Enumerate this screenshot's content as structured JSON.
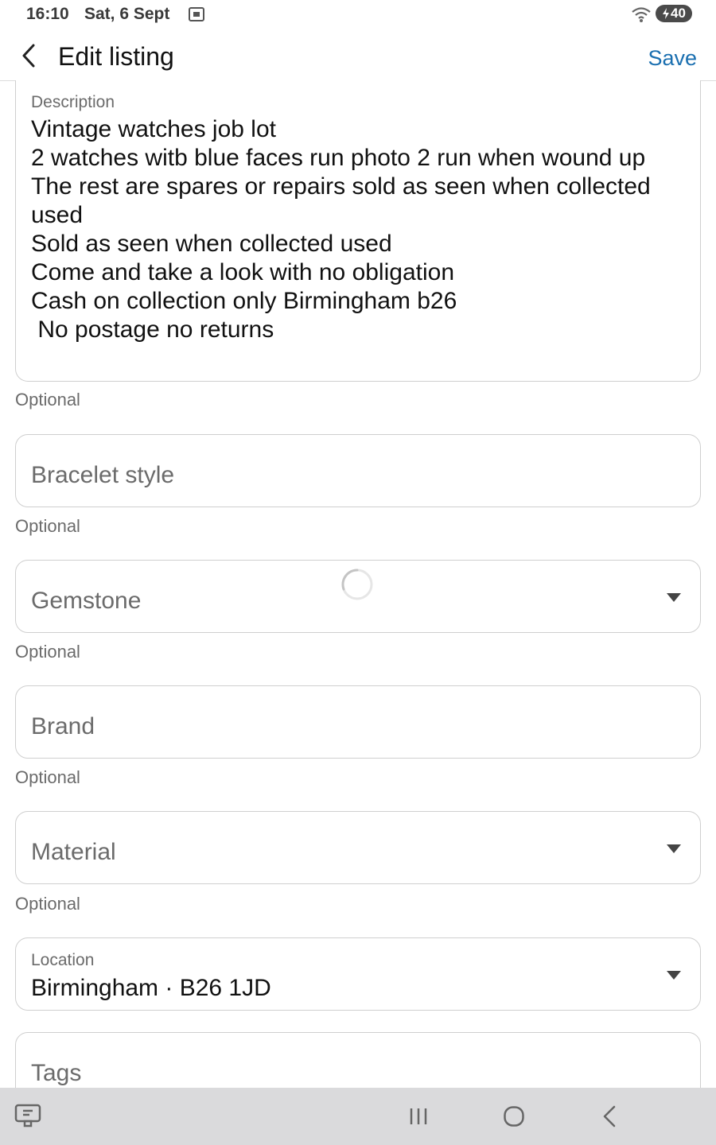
{
  "status": {
    "time": "16:10",
    "date": "Sat, 6 Sept",
    "battery": "40"
  },
  "header": {
    "title": "Edit listing",
    "save_label": "Save"
  },
  "description": {
    "label": "Description",
    "value": "Vintage watches job lot\n2 watches witb blue faces run photo 2 run when wound up\nThe rest are spares or repairs sold as seen when collected used\nSold as seen when collected used\nCome and take a look with no obligation\nCash on collection only Birmingham b26\n No postage no returns",
    "helper": "Optional"
  },
  "bracelet_style": {
    "placeholder": "Bracelet style",
    "helper": "Optional"
  },
  "gemstone": {
    "placeholder": "Gemstone",
    "helper": "Optional"
  },
  "brand": {
    "placeholder": "Brand",
    "helper": "Optional"
  },
  "material": {
    "placeholder": "Material",
    "helper": "Optional"
  },
  "location": {
    "label": "Location",
    "value": "Birmingham · B26 1JD"
  },
  "tags": {
    "placeholder": "Tags"
  },
  "colors": {
    "accent": "#1a6fb0",
    "border": "#cfcfcf",
    "nav_bg": "#dadadc"
  }
}
